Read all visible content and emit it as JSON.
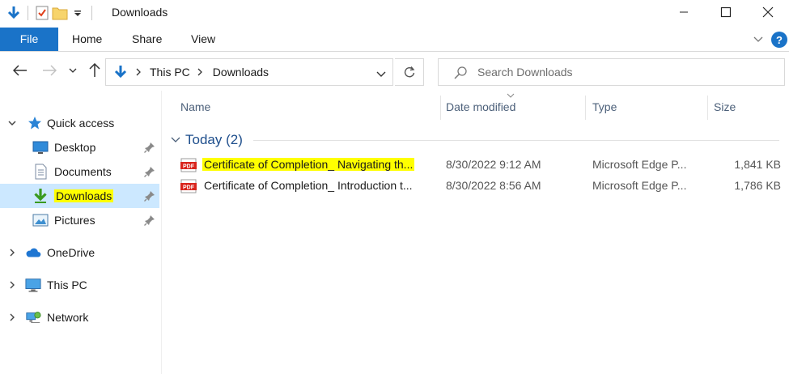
{
  "window": {
    "title": "Downloads"
  },
  "ribbon": {
    "tabs": [
      {
        "label": "File"
      },
      {
        "label": "Home"
      },
      {
        "label": "Share"
      },
      {
        "label": "View"
      }
    ],
    "help_label": "?"
  },
  "address": {
    "crumbs": [
      "This PC",
      "Downloads"
    ]
  },
  "search": {
    "placeholder": "Search Downloads"
  },
  "nav": {
    "quick_access": "Quick access",
    "quick_items": [
      {
        "label": "Desktop",
        "icon": "desktop-icon"
      },
      {
        "label": "Documents",
        "icon": "documents-icon"
      },
      {
        "label": "Downloads",
        "icon": "downloads-icon"
      },
      {
        "label": "Pictures",
        "icon": "pictures-icon"
      }
    ],
    "onedrive": "OneDrive",
    "this_pc": "This PC",
    "network": "Network",
    "selected": "Downloads"
  },
  "columns": {
    "name": "Name",
    "date": "Date modified",
    "type": "Type",
    "size": "Size"
  },
  "group": {
    "label": "Today (2)"
  },
  "files": [
    {
      "name": "Certificate of Completion_ Navigating th...",
      "date": "8/30/2022 9:12 AM",
      "type": "Microsoft Edge P...",
      "size": "1,841 KB",
      "highlighted": true
    },
    {
      "name": "Certificate of Completion_ Introduction t...",
      "date": "8/30/2022 8:56 AM",
      "type": "Microsoft Edge P...",
      "size": "1,786 KB",
      "highlighted": false
    }
  ],
  "colors": {
    "accent": "#1a73c8",
    "selection": "#cce8ff",
    "highlight": "#ffff00",
    "group_text": "#1e4e8c"
  }
}
